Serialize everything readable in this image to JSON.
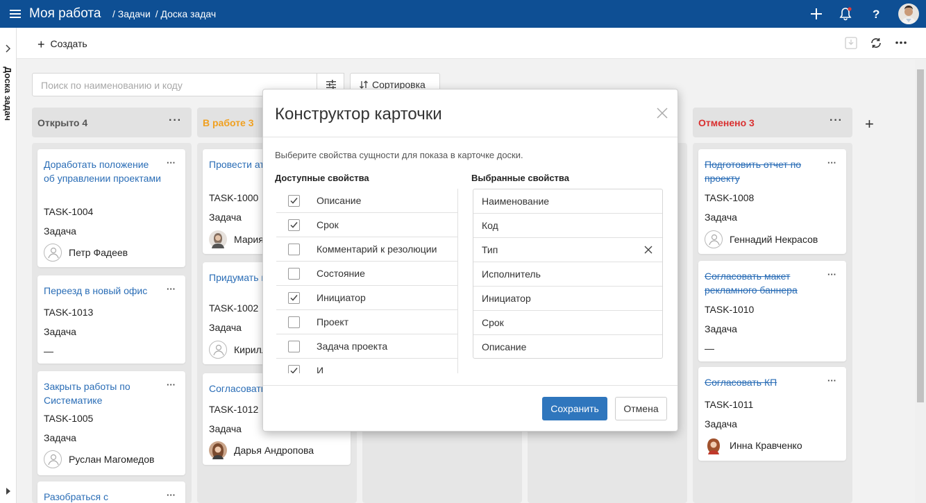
{
  "header": {
    "app_title": "Моя работа",
    "breadcrumbs": [
      "/ Задачи",
      "/ Доска задач"
    ],
    "icons": [
      "menu-icon",
      "plus-icon",
      "bell-icon",
      "help-icon",
      "user-avatar"
    ]
  },
  "sidebar": {
    "vertical_label": "Доска задач"
  },
  "toolbar": {
    "create_label": "Создать"
  },
  "search": {
    "placeholder": "Поиск по наименованию и коду"
  },
  "sort": {
    "label": "Сортировка"
  },
  "columns": [
    {
      "title": "Открыто 4",
      "color": "#555555"
    },
    {
      "title": "В работе 3",
      "color": "#f0a020"
    },
    {
      "title": "Отменено 3",
      "color": "#d93030"
    }
  ],
  "cards": {
    "open": [
      {
        "title": "Доработать положение об управлении проектами",
        "code": "TASK-1004",
        "type": "Задача",
        "assignee": "Петр Фадеев"
      },
      {
        "title": "Переезд в новый офис",
        "code": "TASK-1013",
        "type": "Задача",
        "assignee": "—"
      },
      {
        "title": "Закрыть работы по Систематике",
        "code": "TASK-1005",
        "type": "Задача",
        "assignee": "Руслан Магомедов"
      },
      {
        "title": "Разобраться с"
      }
    ],
    "in_progress": [
      {
        "title": "Провести ат Владимира",
        "code": "TASK-1000",
        "type": "Задача",
        "assignee": "Мария"
      },
      {
        "title": "Придумать внедрению",
        "code": "TASK-1002",
        "type": "Задача",
        "assignee": "Кирилл"
      },
      {
        "title": "Согласовать",
        "code": "TASK-1012",
        "type": "Задача",
        "assignee": "Дарья Андропова"
      }
    ],
    "cancelled": [
      {
        "title": "Подготовить отчет по проекту",
        "code": "TASK-1008",
        "type": "Задача",
        "assignee": "Геннадий Некрасов"
      },
      {
        "title": "Согласовать макет рекламного баннера",
        "code": "TASK-1010",
        "type": "Задача",
        "assignee": "—"
      },
      {
        "title": "Согласовать КП",
        "code": "TASK-1011",
        "type": "Задача",
        "assignee": "Инна Кравченко"
      }
    ]
  },
  "dialog": {
    "title": "Конструктор карточки",
    "hint": "Выберите свойства сущности для показа в карточке доски.",
    "available_header": "Доступные свойства",
    "selected_header": "Выбранные свойства",
    "available": [
      {
        "label": "Описание",
        "checked": true
      },
      {
        "label": "Срок",
        "checked": true
      },
      {
        "label": "Комментарий к резолюции",
        "checked": false
      },
      {
        "label": "Состояние",
        "checked": false
      },
      {
        "label": "Инициатор",
        "checked": true
      },
      {
        "label": "Проект",
        "checked": false
      },
      {
        "label": "Задача проекта",
        "checked": false
      },
      {
        "label": "И",
        "checked": true
      }
    ],
    "selected": [
      "Наименование",
      "Код",
      "Тип",
      "Исполнитель",
      "Инициатор",
      "Срок",
      "Описание"
    ],
    "save_label": "Сохранить",
    "cancel_label": "Отмена"
  },
  "colors": {
    "header_bg": "#0e4f94",
    "link": "#2a6db6",
    "primary_button": "#2f76bd"
  }
}
